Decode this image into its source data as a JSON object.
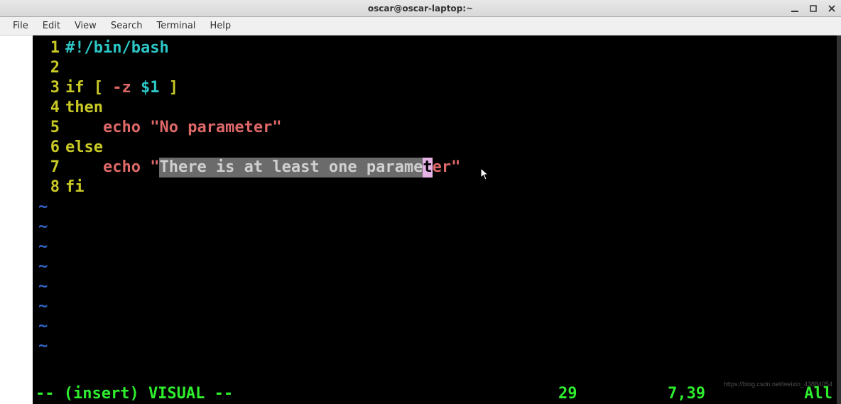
{
  "window": {
    "title": "oscar@oscar-laptop:~"
  },
  "menubar": {
    "items": [
      "File",
      "Edit",
      "View",
      "Search",
      "Terminal",
      "Help"
    ]
  },
  "editor": {
    "lines": [
      {
        "num": "1",
        "tokens": [
          {
            "t": "#!/bin/bash",
            "c": "c-cyan"
          }
        ]
      },
      {
        "num": "2",
        "tokens": []
      },
      {
        "num": "3",
        "tokens": [
          {
            "t": "if",
            "c": "c-yellow"
          },
          {
            "t": " ",
            "c": "c-white"
          },
          {
            "t": "[",
            "c": "c-yellow"
          },
          {
            "t": " ",
            "c": "c-white"
          },
          {
            "t": "-z",
            "c": "c-salmon"
          },
          {
            "t": " ",
            "c": "c-white"
          },
          {
            "t": "$1",
            "c": "c-cyan"
          },
          {
            "t": " ",
            "c": "c-white"
          },
          {
            "t": "]",
            "c": "c-yellow"
          }
        ]
      },
      {
        "num": "4",
        "tokens": [
          {
            "t": "then",
            "c": "c-yellow"
          }
        ]
      },
      {
        "num": "5",
        "tokens": [
          {
            "t": "    ",
            "c": "c-white"
          },
          {
            "t": "echo",
            "c": "c-salmon"
          },
          {
            "t": " ",
            "c": "c-white"
          },
          {
            "t": "\"No parameter\"",
            "c": "c-salmon"
          }
        ]
      },
      {
        "num": "6",
        "tokens": [
          {
            "t": "else",
            "c": "c-yellow"
          }
        ]
      },
      {
        "num": "7",
        "tokens": [
          {
            "t": "    ",
            "c": "c-white"
          },
          {
            "t": "echo",
            "c": "c-salmon"
          },
          {
            "t": " ",
            "c": "c-white"
          },
          {
            "t": "\"",
            "c": "c-salmon"
          },
          {
            "t": "There is at least one parame",
            "c": "vsel"
          },
          {
            "t": "t",
            "c": "vcursor"
          },
          {
            "t": "er",
            "c": "c-salmon"
          },
          {
            "t": "\"",
            "c": "c-salmon"
          }
        ]
      },
      {
        "num": "8",
        "tokens": [
          {
            "t": "fi",
            "c": "c-yellow"
          }
        ]
      }
    ],
    "tilde_count": 8
  },
  "status": {
    "mode": "-- (insert) VISUAL --",
    "count": "29",
    "position": "7,39",
    "scroll": "All"
  },
  "watermark": "https://blog.csdn.net/weixin_43884054",
  "tilde_char": "~"
}
